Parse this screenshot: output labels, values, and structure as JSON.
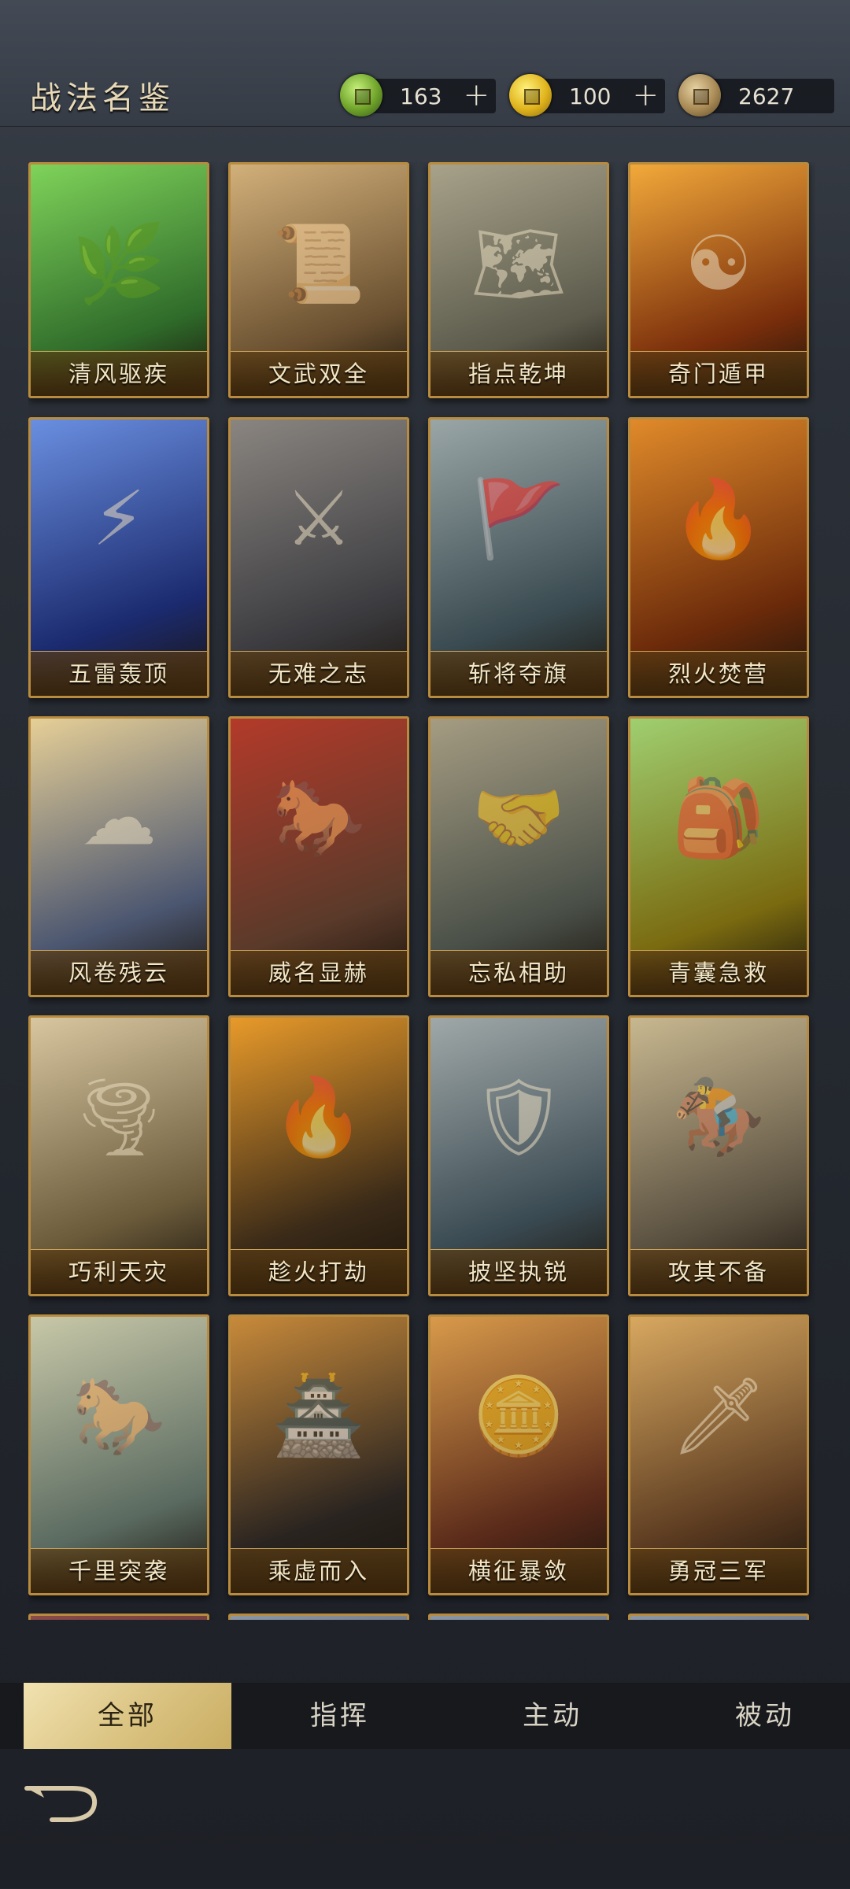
{
  "header": {
    "title": "战法名鉴",
    "resources": [
      {
        "icon": "jade-coin-icon",
        "value": "163",
        "add": "+"
      },
      {
        "icon": "gold-coin-icon",
        "value": "100",
        "add": "+"
      },
      {
        "icon": "copper-coin-icon",
        "value": "2627"
      }
    ]
  },
  "cards": [
    {
      "label": "清风驱疾",
      "glyph": "🌿",
      "color1": "#2f6b2a",
      "color2": "#7fd35a"
    },
    {
      "label": "文武双全",
      "glyph": "📜",
      "color1": "#6a5030",
      "color2": "#d2b07a"
    },
    {
      "label": "指点乾坤",
      "glyph": "🗺",
      "color1": "#5b5a4b",
      "color2": "#a8a28a"
    },
    {
      "label": "奇门遁甲",
      "glyph": "☯",
      "color1": "#7a2e0b",
      "color2": "#f2a93a"
    },
    {
      "label": "五雷轰顶",
      "glyph": "⚡",
      "color1": "#1b2a6e",
      "color2": "#6a8fe0"
    },
    {
      "label": "无难之志",
      "glyph": "⚔",
      "color1": "#3c3c40",
      "color2": "#8a8580"
    },
    {
      "label": "斩将夺旗",
      "glyph": "🚩",
      "color1": "#394a50",
      "color2": "#9aa6a6"
    },
    {
      "label": "烈火焚营",
      "glyph": "🔥",
      "color1": "#6b2a0a",
      "color2": "#e08a2a"
    },
    {
      "label": "风卷残云",
      "glyph": "☁",
      "color1": "#4b5670",
      "color2": "#e6cf97"
    },
    {
      "label": "威名显赫",
      "glyph": "🐎",
      "color1": "#5a3a2a",
      "color2": "#b33a2a"
    },
    {
      "label": "忘私相助",
      "glyph": "🤝",
      "color1": "#4a5048",
      "color2": "#a59c82"
    },
    {
      "label": "青囊急救",
      "glyph": "🎒",
      "color1": "#7a6a10",
      "color2": "#9fcf70"
    },
    {
      "label": "巧利天灾",
      "glyph": "🌪",
      "color1": "#6a5a3a",
      "color2": "#d8c6a0"
    },
    {
      "label": "趁火打劫",
      "glyph": "🔥",
      "color1": "#3a2a18",
      "color2": "#e89a2a"
    },
    {
      "label": "披坚执锐",
      "glyph": "🛡",
      "color1": "#3a4a52",
      "color2": "#a0a8a8"
    },
    {
      "label": "攻其不备",
      "glyph": "🏇",
      "color1": "#5a5040",
      "color2": "#c8b890"
    },
    {
      "label": "千里突袭",
      "glyph": "🐎",
      "color1": "#5a6a60",
      "color2": "#c8c8a8"
    },
    {
      "label": "乘虚而入",
      "glyph": "🏯",
      "color1": "#2a2420",
      "color2": "#c88a3a"
    },
    {
      "label": "横征暴敛",
      "glyph": "🪙",
      "color1": "#5a2a1a",
      "color2": "#d89a4a"
    },
    {
      "label": "勇冠三军",
      "glyph": "🗡",
      "color1": "#5a3a20",
      "color2": "#d8a860"
    },
    {
      "label": "",
      "glyph": "",
      "color1": "#4a2a2a",
      "color2": "#8a4a4a"
    },
    {
      "label": "",
      "glyph": "",
      "color1": "#4a5058",
      "color2": "#8a96a4"
    },
    {
      "label": "",
      "glyph": "",
      "color1": "#4a5058",
      "color2": "#8a96a4"
    },
    {
      "label": "",
      "glyph": "",
      "color1": "#4a5058",
      "color2": "#8a96a4"
    }
  ],
  "tabs": [
    {
      "label": "全部",
      "active": true
    },
    {
      "label": "指挥",
      "active": false
    },
    {
      "label": "主动",
      "active": false
    },
    {
      "label": "被动",
      "active": false
    }
  ],
  "back": {
    "icon": "back-arrow-icon"
  }
}
